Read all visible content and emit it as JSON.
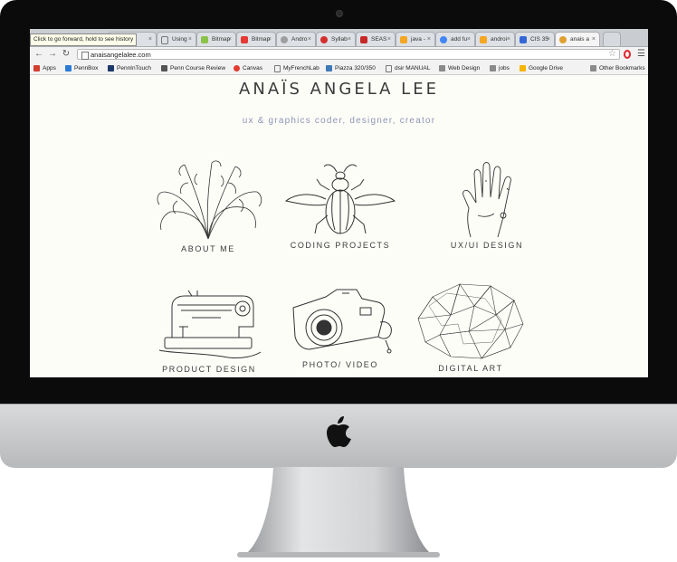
{
  "browser": {
    "tooltip": "Click to go forward, hold to see history",
    "tabs": [
      {
        "label": "Using",
        "color": "#7a7a7a"
      },
      {
        "label": "Bitmap",
        "color": "#8bc34a"
      },
      {
        "label": "Bitmap",
        "color": "#e53935"
      },
      {
        "label": "Andro",
        "color": "#9e9e9e"
      },
      {
        "label": "Syllab",
        "color": "#d32f2f"
      },
      {
        "label": "SEAS",
        "color": "#c62828"
      },
      {
        "label": "java -",
        "color": "#f5a623"
      },
      {
        "label": "add fu",
        "color": "#4285f4"
      },
      {
        "label": "androi",
        "color": "#f5a623"
      },
      {
        "label": "CIS 35",
        "color": "#3367d6"
      },
      {
        "label": "anais a",
        "color": "#e0a030"
      }
    ],
    "address": "anaisangelalee.com",
    "bookmarks": [
      {
        "label": "Apps",
        "color": "#d23f31"
      },
      {
        "label": "PennBox",
        "color": "#2b7bd6"
      },
      {
        "label": "PennInTouch",
        "color": "#1b3a6b"
      },
      {
        "label": "Penn Course Review",
        "color": "#555555"
      },
      {
        "label": "Canvas",
        "color": "#e23b2e"
      },
      {
        "label": "MyFrenchLab",
        "color": "#777777"
      },
      {
        "label": "Piazza 320/350",
        "color": "#3e7bb6"
      },
      {
        "label": "dsir MANUAL",
        "color": "#777777"
      },
      {
        "label": "Web Design",
        "color": "#8a8a8a"
      },
      {
        "label": "jobs",
        "color": "#8a8a8a"
      },
      {
        "label": "Google Drive",
        "color": "#f4b400"
      },
      {
        "label": "Other Bookmarks",
        "color": "#8a8a8a"
      }
    ]
  },
  "site": {
    "title": "ANAÏS ANGELA LEE",
    "tagline": "ux & graphics coder, designer, creator",
    "items": [
      {
        "label": "ABOUT ME",
        "icon": "seaweed-icon"
      },
      {
        "label": "CODING PROJECTS",
        "icon": "beetle-icon"
      },
      {
        "label": "UX/UI DESIGN",
        "icon": "hand-icon"
      },
      {
        "label": "PRODUCT DESIGN",
        "icon": "sewing-machine-icon"
      },
      {
        "label": "PHOTO/ VIDEO",
        "icon": "camera-icon"
      },
      {
        "label": "DIGITAL ART",
        "icon": "polygon-mesh-icon"
      }
    ]
  }
}
